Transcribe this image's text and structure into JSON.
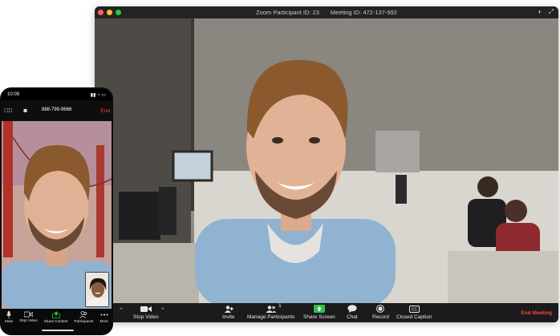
{
  "desktop": {
    "title_left": "Zoom Participant ID: 23",
    "title_right": "Meeting ID: 472-137-992",
    "toolbar": {
      "stop_video": "Stop Video",
      "invite": "Invite",
      "manage_participants": "Manage Participants",
      "participant_count": "1",
      "share_screen": "Share Screen",
      "chat": "Chat",
      "record": "Record",
      "closed_caption": "Closed Caption",
      "end_meeting": "End Meeting"
    }
  },
  "phone": {
    "time": "10:09",
    "phone_number": "888-799-9666",
    "end": "End",
    "bottom": {
      "mute": "Mute",
      "stop_video": "Stop Video",
      "share_content": "Share Content",
      "participants": "Participants",
      "more": "More"
    }
  },
  "colors": {
    "end_red": "#ff453a",
    "share_green": "#2fbf4a",
    "toolbar_bg": "#1b1b1d"
  }
}
